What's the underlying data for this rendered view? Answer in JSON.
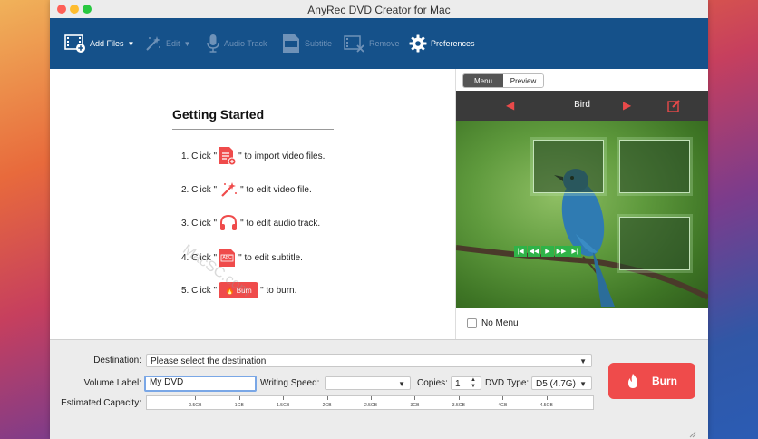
{
  "window": {
    "title": "AnyRec DVD Creator for Mac"
  },
  "toolbar": {
    "add_files": "Add Files",
    "edit": "Edit",
    "audio_track": "Audio Track",
    "subtitle": "Subtitle",
    "remove": "Remove",
    "preferences": "Preferences"
  },
  "getting_started": {
    "title": "Getting Started",
    "steps": [
      {
        "prefix": "1. Click \"",
        "suffix": "\" to import video files."
      },
      {
        "prefix": "2. Click \"",
        "suffix": "\" to edit video file."
      },
      {
        "prefix": "3. Click \"",
        "suffix": "\" to edit audio track."
      },
      {
        "prefix": "4. Click \"",
        "suffix": "\" to edit subtitle."
      },
      {
        "prefix": "5. Click \"",
        "suffix": "\" to burn."
      }
    ],
    "burn_mini_label": "Burn",
    "subtitle_icon_text": "ABC"
  },
  "preview_panel": {
    "tab_menu": "Menu",
    "tab_preview": "Preview",
    "menu_title": "Bird",
    "no_menu": "No Menu"
  },
  "bottom": {
    "destination_label": "Destination:",
    "destination_value": "Please select the destination",
    "volume_label": "Volume Label:",
    "volume_value": "My DVD",
    "writing_speed_label": "Writing Speed:",
    "writing_speed_value": "",
    "copies_label": "Copies:",
    "copies_value": "1",
    "dvd_type_label": "DVD Type:",
    "dvd_type_value": "D5 (4.7G)",
    "capacity_label": "Estimated Capacity:",
    "capacity_ticks": [
      "0.5GB",
      "1GB",
      "1.5GB",
      "2GB",
      "2.5GB",
      "3GB",
      "3.5GB",
      "4GB",
      "4.5GB"
    ],
    "burn_label": "Burn"
  },
  "watermark": {
    "text": "MacSC.com"
  },
  "colors": {
    "toolbar_bg": "#15518a",
    "accent_red": "#ef4b4b",
    "preview_nav_bg": "#3a3a3a",
    "control_green": "#2fb348"
  }
}
